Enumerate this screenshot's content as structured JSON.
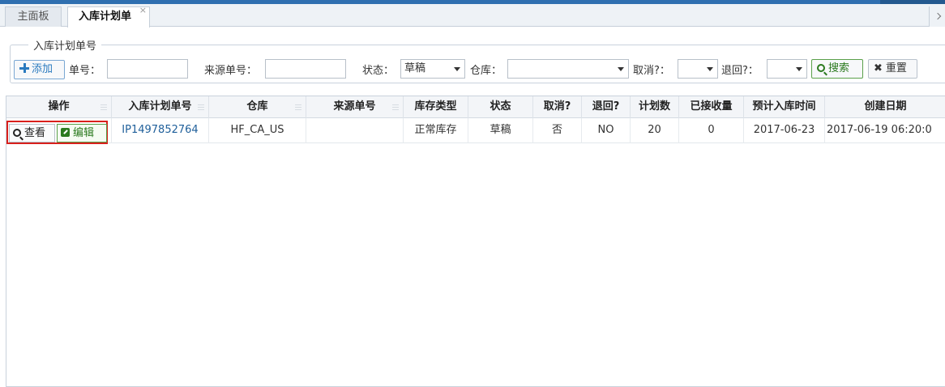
{
  "tabs": [
    {
      "label": "主面板"
    },
    {
      "label": "入库计划单",
      "close": "×"
    }
  ],
  "search": {
    "legend": "入库计划单号",
    "add_label": "添加",
    "order_no_label": "单号：",
    "order_no_value": "",
    "source_no_label": "来源单号：",
    "source_no_value": "",
    "status_label": "状态：",
    "status_value": "草稿",
    "warehouse_label": "仓库：",
    "warehouse_value": "",
    "cancel_label": "取消?：",
    "cancel_value": "",
    "return_label": "退回?：",
    "return_value": "",
    "search_label": "搜索",
    "reset_label": "重置"
  },
  "table": {
    "columns": [
      "操作",
      "入库计划单号",
      "仓库",
      "来源单号",
      "库存类型",
      "状态",
      "取消?",
      "退回?",
      "计划数",
      "已接收量",
      "预计入库时间",
      "创建日期"
    ],
    "rows": [
      {
        "view_label": "查看",
        "edit_label": "编辑",
        "plan_no": "IP1497852764",
        "warehouse": "HF_CA_US",
        "source_no": "",
        "stock_type": "正常库存",
        "status": "草稿",
        "cancelled": "否",
        "returned": "NO",
        "planned_qty": "20",
        "received_qty": "0",
        "expected_time": "2017-06-23",
        "created_at": "2017-06-19 06:20:0"
      }
    ]
  },
  "colors": {
    "accent_blue": "#2f6fb0",
    "link": "#1f5f9a",
    "green": "#2b7a1e",
    "highlight_red": "#d9201c"
  }
}
